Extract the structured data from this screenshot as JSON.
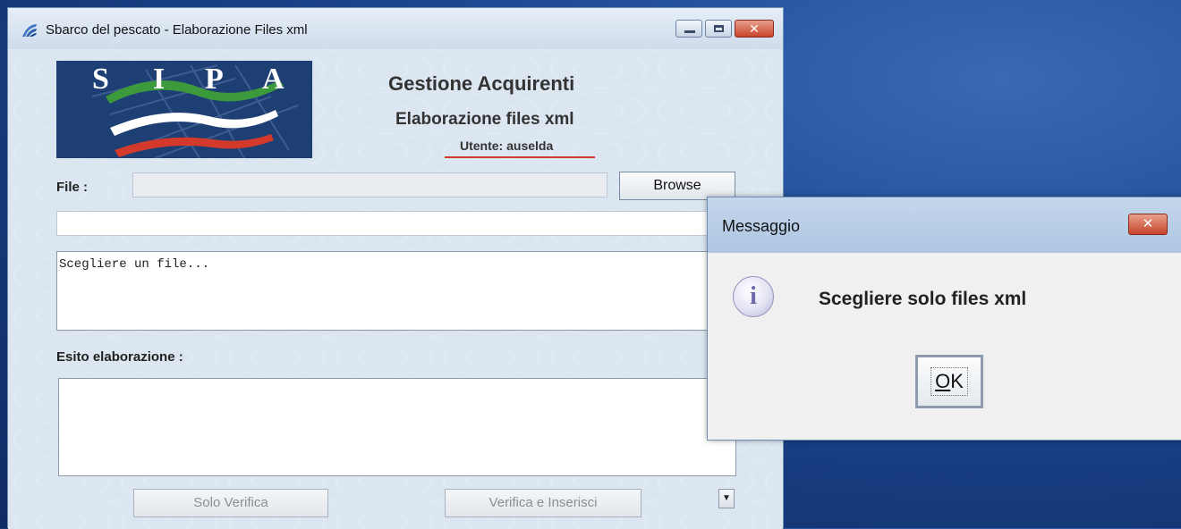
{
  "main_window": {
    "title": "Sbarco del pescato - Elaborazione Files xml",
    "buttons": {
      "minimize": "minimize",
      "maximize": "maximize",
      "close": "✕"
    }
  },
  "logo": {
    "letters": [
      "S",
      "I",
      "P",
      "A"
    ]
  },
  "header": {
    "title": "Gestione Acquirenti",
    "subtitle": "Elaborazione files xml",
    "user": "Utente: auselda"
  },
  "form": {
    "file_label": "File :",
    "browse_label": "Browse",
    "message_text": "Scegliere un file...",
    "esito_label": "Esito elaborazione :",
    "solo_verifica_label": "Solo Verifica",
    "verifica_inserisci_label": "Verifica e Inserisci"
  },
  "dialog": {
    "title": "Messaggio",
    "close_label": "✕",
    "message": "Scegliere solo files xml",
    "ok_first": "O",
    "ok_rest": "K",
    "icon": "info-icon"
  },
  "colors": {
    "desktop": "#1f4a94",
    "window_bg": "#dbe6f1",
    "close_red": "#c8442b",
    "logo_bg": "#1e3f74",
    "user_underline": "#d33a2c"
  }
}
